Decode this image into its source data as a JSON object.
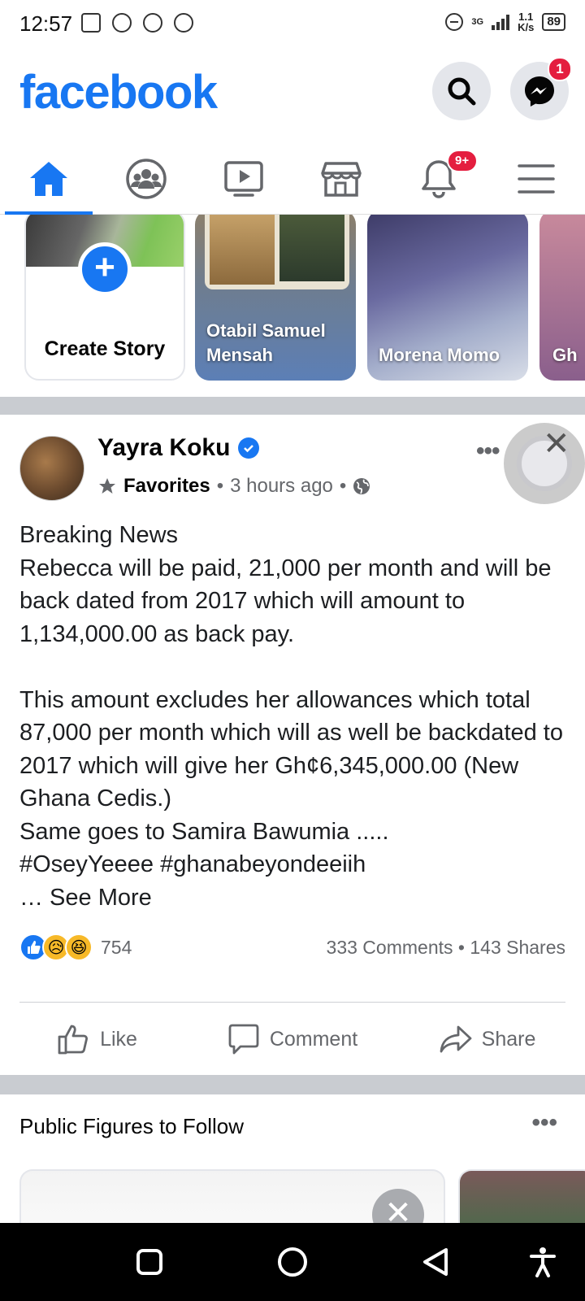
{
  "status_bar": {
    "time": "12:57",
    "network": "3G",
    "speed_value": "1.1",
    "speed_unit": "K/s",
    "battery": "89"
  },
  "header": {
    "logo": "facebook",
    "messenger_badge": "1"
  },
  "tabs": {
    "notifications_badge": "9+"
  },
  "stories": [
    {
      "label": "Create Story"
    },
    {
      "label": "Otabil Samuel Mensah"
    },
    {
      "label": "Morena Momo"
    },
    {
      "label": "Gh A"
    }
  ],
  "post": {
    "author": "Yayra Koku",
    "audience": "Favorites",
    "time": "3 hours ago",
    "text": "Breaking News\nRebecca will be paid, 21,000 per month and will be back dated from 2017 which will amount to 1,134,000.00 as back pay.\n\nThis amount excludes her allowances which total 87,000 per month which will as well be backdated to 2017 which will give her Gh¢6,345,000.00 (New Ghana Cedis.)\nSame goes to Samira Bawumia .....\n#OseyYeeee  #ghanabeyondeeiih\n… See More",
    "reaction_count": "754",
    "comments": "333 Comments",
    "shares": "143 Shares",
    "separator": "•"
  },
  "actions": {
    "like": "Like",
    "comment": "Comment",
    "share": "Share"
  },
  "suggestions": {
    "title": "Public Figures to Follow"
  },
  "colors": {
    "brand": "#1877f2",
    "badge": "#e41e3f",
    "divider": "#c9ccd1"
  }
}
